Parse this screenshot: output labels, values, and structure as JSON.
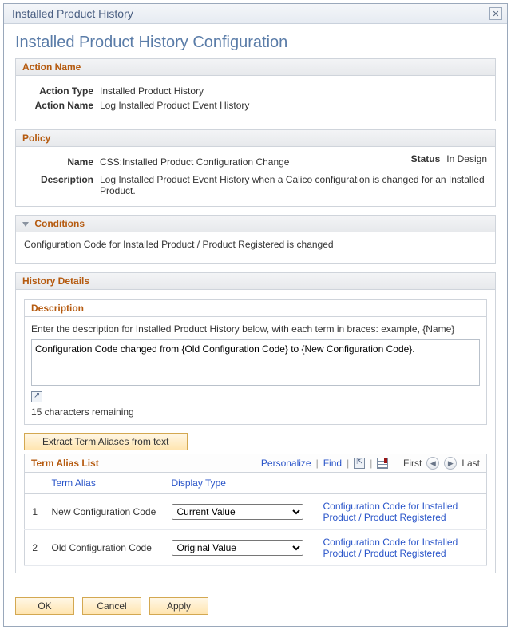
{
  "dialog": {
    "title": "Installed Product History",
    "page_title": "Installed Product History Configuration"
  },
  "action": {
    "header": "Action Name",
    "type_label": "Action Type",
    "type_value": "Installed Product History",
    "name_label": "Action Name",
    "name_value": "Log Installed Product Event History"
  },
  "policy": {
    "header": "Policy",
    "name_label": "Name",
    "name_value": "CSS:Installed Product Configuration Change",
    "status_label": "Status",
    "status_value": "In Design",
    "desc_label": "Description",
    "desc_value": "Log Installed Product Event History when a Calico configuration is changed for an Installed Product."
  },
  "conditions": {
    "header": "Conditions",
    "text": "Configuration Code for Installed Product / Product Registered is changed"
  },
  "history": {
    "header": "History Details",
    "desc_header": "Description",
    "help": "Enter the description for Installed Product History below, with each term in braces: example, {Name}",
    "textarea_value": "Configuration Code changed from {Old Configuration Code} to {New Configuration Code}.",
    "remaining": "15 characters remaining",
    "extract_btn": "Extract Term Aliases from text"
  },
  "term_alias": {
    "header": "Term Alias List",
    "personalize": "Personalize",
    "find": "Find",
    "first": "First",
    "last": "Last",
    "col_alias": "Term Alias",
    "col_display": "Display Type",
    "rows": [
      {
        "num": "1",
        "alias": "New Configuration Code",
        "display": "Current Value",
        "link": "Configuration Code for Installed Product / Product Registered"
      },
      {
        "num": "2",
        "alias": "Old Configuration Code",
        "display": "Original Value",
        "link": "Configuration Code for Installed Product / Product Registered"
      }
    ]
  },
  "buttons": {
    "ok": "OK",
    "cancel": "Cancel",
    "apply": "Apply"
  }
}
